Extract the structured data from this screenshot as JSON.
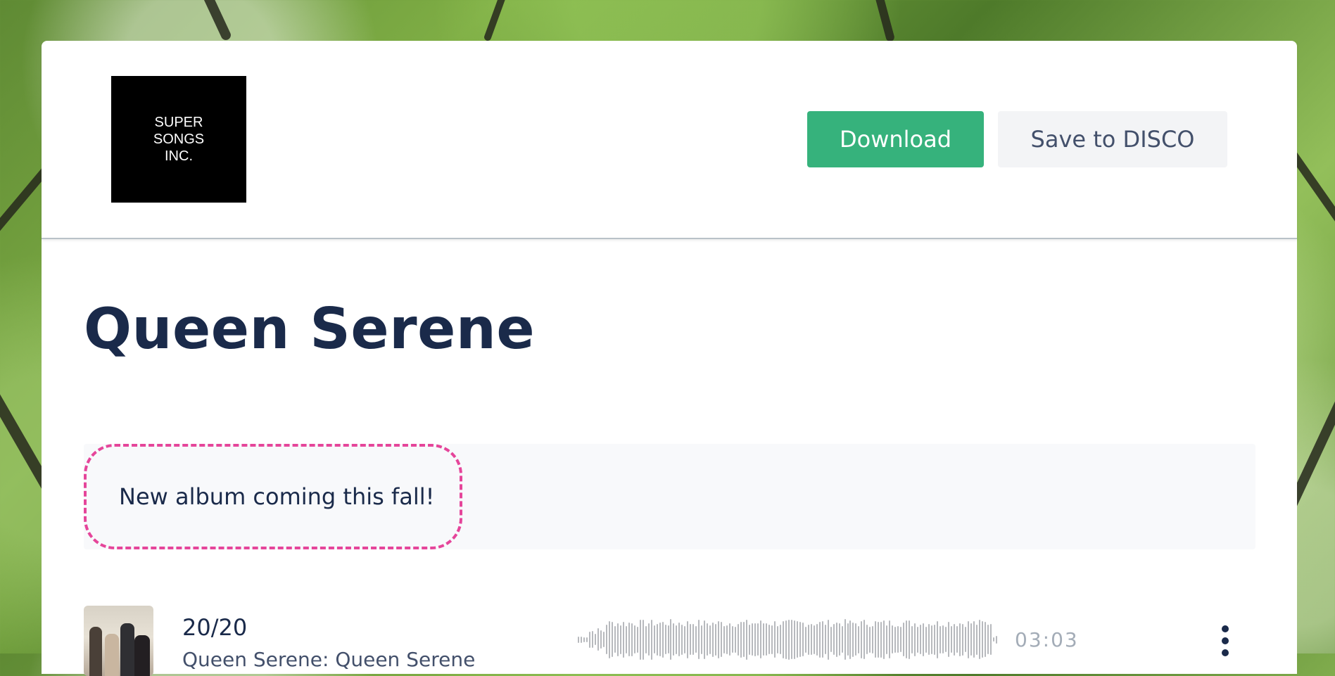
{
  "header": {
    "logo_text": "SUPER\nSONGS\nINC.",
    "download_label": "Download",
    "save_label": "Save to DISCO"
  },
  "playlist": {
    "title": "Queen Serene",
    "notice": "New album coming this fall!"
  },
  "tracks": [
    {
      "title": "20/20",
      "subtitle": "Queen Serene: Queen Serene",
      "duration": "03:03",
      "artwork": "band-photo"
    }
  ],
  "icons": {
    "track_menu": "more-vertical-icon"
  },
  "colors": {
    "accent": "#36b27c",
    "title": "#1a2a4a",
    "notice_border": "#e5459a",
    "waveform": "#b7b9bd"
  }
}
